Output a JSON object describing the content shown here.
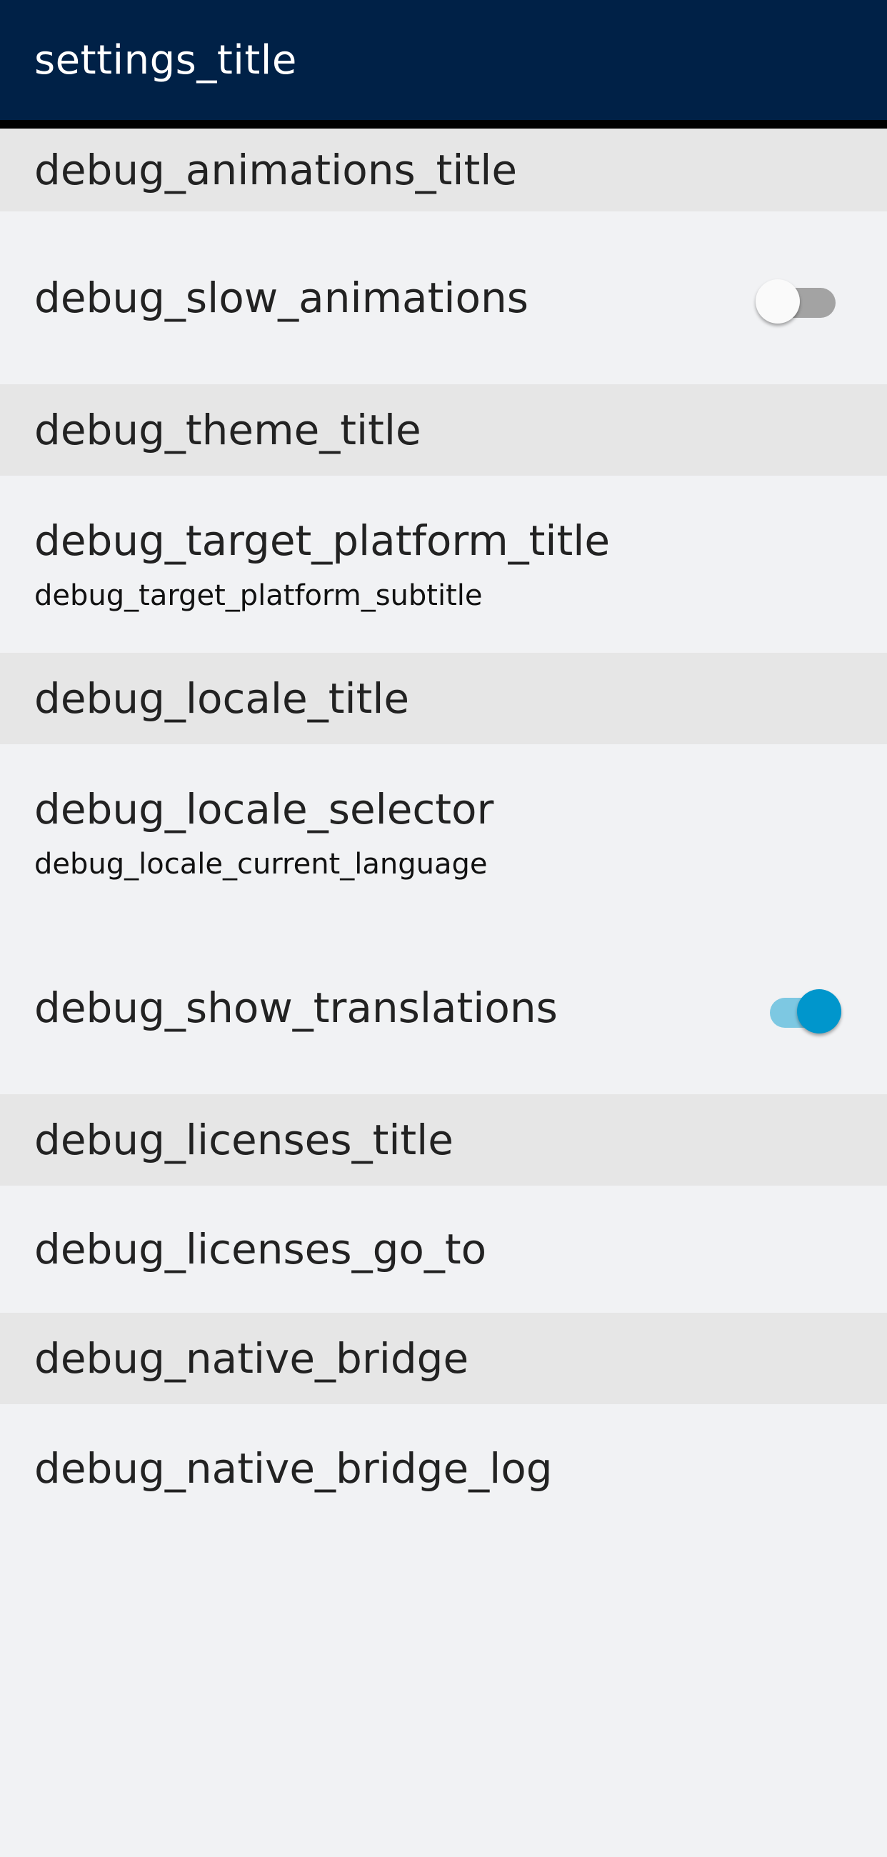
{
  "app_bar": {
    "title": "settings_title",
    "background_color": "#002147"
  },
  "sections": {
    "animations": {
      "header": "debug_animations_title",
      "slow_animations": {
        "label": "debug_slow_animations",
        "enabled": false
      }
    },
    "theme": {
      "header": "debug_theme_title",
      "target_platform": {
        "title": "debug_target_platform_title",
        "subtitle": "debug_target_platform_subtitle"
      }
    },
    "locale": {
      "header": "debug_locale_title",
      "selector": {
        "title": "debug_locale_selector",
        "subtitle": "debug_locale_current_language"
      },
      "show_translations": {
        "label": "debug_show_translations",
        "enabled": true
      }
    },
    "licenses": {
      "header": "debug_licenses_title",
      "go_to": "debug_licenses_go_to"
    },
    "native_bridge": {
      "header": "debug_native_bridge",
      "log": "debug_native_bridge_log"
    }
  },
  "colors": {
    "switch_on_thumb": "#0096cc",
    "switch_on_track": "#7dc8e2",
    "switch_off_thumb": "#fafafa",
    "switch_off_track": "#a3a3a3",
    "section_header_bg": "#e6e6e6",
    "page_bg": "#f1f2f4"
  }
}
